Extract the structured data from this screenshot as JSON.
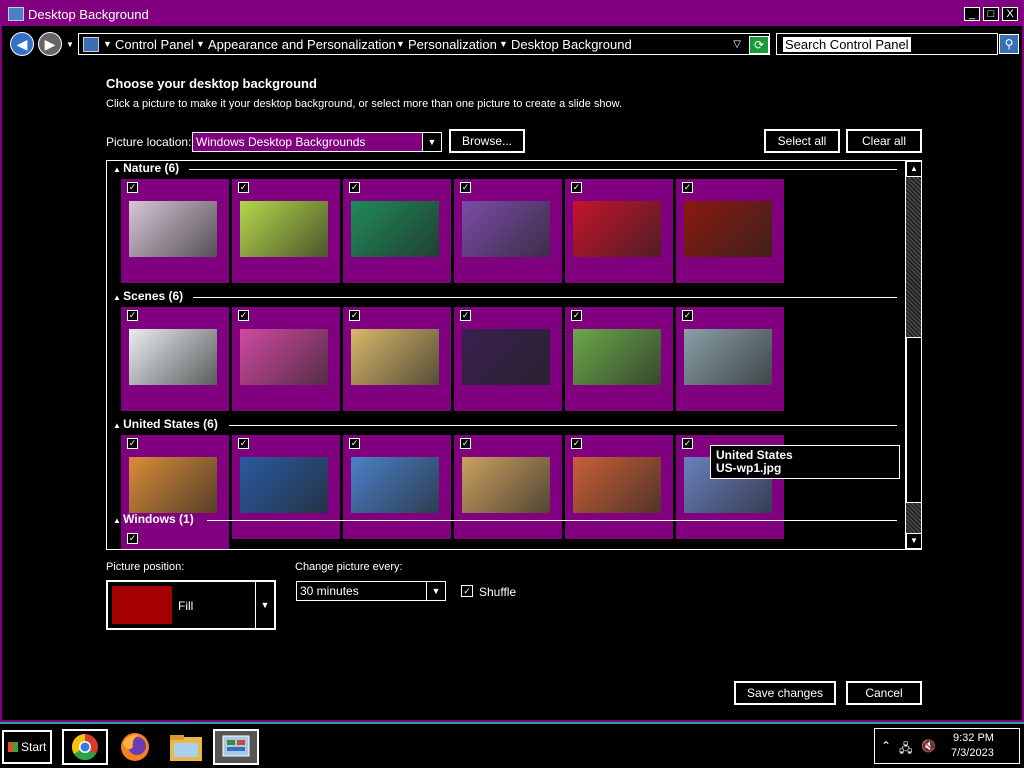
{
  "window": {
    "title": "Desktop Background",
    "controls": [
      "_",
      "□",
      "X"
    ]
  },
  "address": {
    "crumbs": [
      "Control Panel",
      "Appearance and Personalization",
      "Personalization",
      "Desktop Background"
    ],
    "search_placeholder": "Search Control Panel"
  },
  "content": {
    "heading": "Choose your desktop background",
    "subheading": "Click a picture to make it your desktop background, or select more than one picture to create a slide show.",
    "location_label": "Picture location:",
    "location_value": "Windows Desktop Backgrounds",
    "browse_label": "Browse...",
    "select_all_label": "Select all",
    "clear_all_label": "Clear all"
  },
  "gallery": {
    "groups": [
      {
        "name": "Nature (6)",
        "count": 6,
        "colors": [
          "#d7c6d6",
          "#b5d84a",
          "#1f8a5a",
          "#7a4ca6",
          "#c4142a",
          "#8a1a10"
        ]
      },
      {
        "name": "Scenes (6)",
        "count": 6,
        "colors": [
          "#e8eef0",
          "#d04aa0",
          "#d8b86a",
          "#3a2050",
          "#6aa84a",
          "#8aa0a8"
        ]
      },
      {
        "name": "United States (6)",
        "count": 6,
        "colors": [
          "#d98c3a",
          "#2a5aa0",
          "#4a80c8",
          "#caa060",
          "#c86038",
          "#6a80c0"
        ]
      },
      {
        "name": "Windows (1)",
        "count": 1,
        "colors": [
          "#2a6ac8"
        ]
      }
    ],
    "tooltip": {
      "line1": "United States",
      "line2": "US-wp1.jpg"
    }
  },
  "settings": {
    "position_label": "Picture position:",
    "position_value": "Fill",
    "change_label": "Change picture every:",
    "change_value": "30 minutes",
    "shuffle_label": "Shuffle",
    "shuffle_checked": true
  },
  "footer": {
    "save_label": "Save changes",
    "cancel_label": "Cancel"
  },
  "taskbar": {
    "start_label": "Start",
    "time": "9:32 PM",
    "date": "7/3/2023"
  }
}
